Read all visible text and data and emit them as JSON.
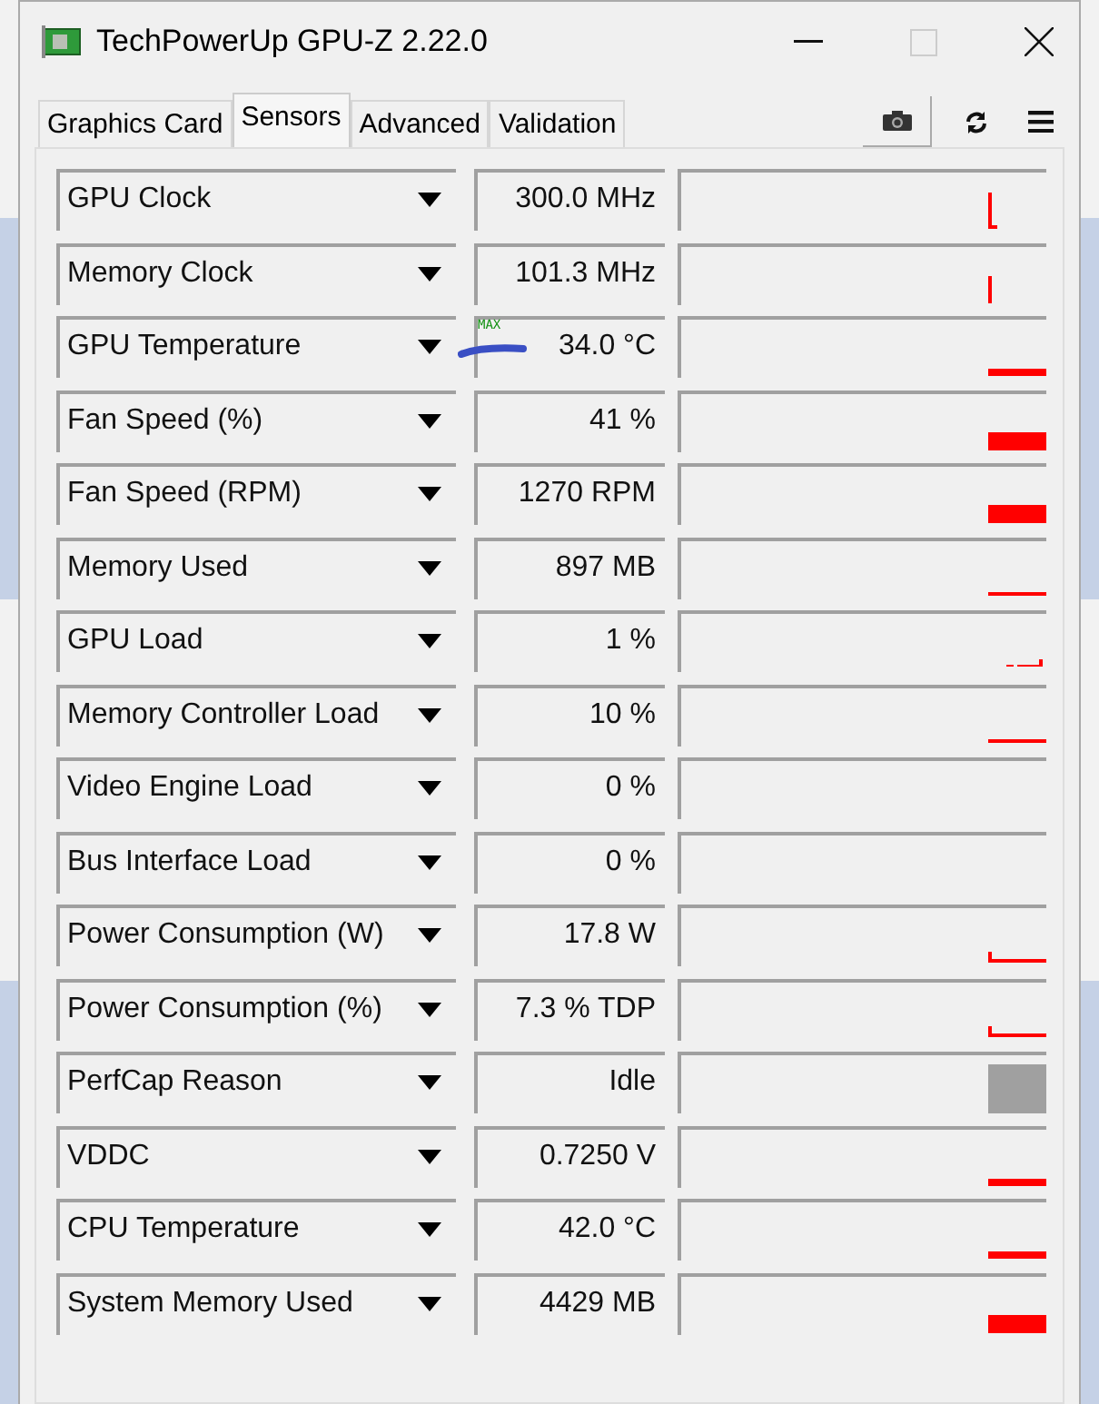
{
  "window": {
    "title": "TechPowerUp GPU-Z 2.22.0"
  },
  "tabs": [
    {
      "label": "Graphics Card",
      "selected": false
    },
    {
      "label": "Sensors",
      "selected": true
    },
    {
      "label": "Advanced",
      "selected": false
    },
    {
      "label": "Validation",
      "selected": false
    }
  ],
  "sensors": [
    {
      "name": "GPU Clock",
      "value": "300.0 MHz",
      "kind": "spike"
    },
    {
      "name": "Memory Clock",
      "value": "101.3 MHz",
      "kind": "tick"
    },
    {
      "name": "GPU Temperature",
      "value": "34.0 °C",
      "kind": "line",
      "badge": "MAX",
      "scribble": true
    },
    {
      "name": "Fan Speed (%)",
      "value": "41 %",
      "kind": "bar"
    },
    {
      "name": "Fan Speed (RPM)",
      "value": "1270 RPM",
      "kind": "bar"
    },
    {
      "name": "Memory Used",
      "value": "897 MB",
      "kind": "thin"
    },
    {
      "name": "GPU Load",
      "value": "1 %",
      "kind": "dots"
    },
    {
      "name": "Memory Controller Load",
      "value": "10 %",
      "kind": "thin"
    },
    {
      "name": "Video Engine Load",
      "value": "0 %",
      "kind": "empty"
    },
    {
      "name": "Bus Interface Load",
      "value": "0 %",
      "kind": "empty"
    },
    {
      "name": "Power Consumption (W)",
      "value": "17.8 W",
      "kind": "step"
    },
    {
      "name": "Power Consumption (%)",
      "value": "7.3 % TDP",
      "kind": "step"
    },
    {
      "name": "PerfCap Reason",
      "value": "Idle",
      "kind": "block"
    },
    {
      "name": "VDDC",
      "value": "0.7250 V",
      "kind": "line"
    },
    {
      "name": "CPU Temperature",
      "value": "42.0 °C",
      "kind": "line"
    },
    {
      "name": "System Memory Used",
      "value": "4429 MB",
      "kind": "bar"
    }
  ]
}
